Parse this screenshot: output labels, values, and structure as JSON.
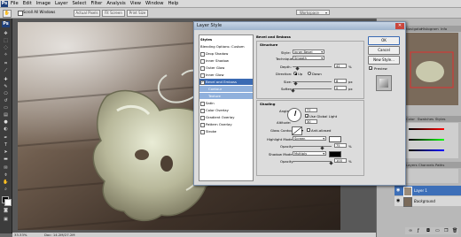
{
  "app_logo": "Ps",
  "menu": [
    "File",
    "Edit",
    "Image",
    "Layer",
    "Select",
    "Filter",
    "Analysis",
    "View",
    "Window",
    "Help"
  ],
  "options_bar": {
    "scroll_all_windows": "Scroll All Windows",
    "actual_pixels": "Actual Pixels",
    "fit_screen": "Fit Screen",
    "print_size": "Print Size",
    "workspace": "Workspace"
  },
  "status_bar": {
    "zoom": "33.33%",
    "doc": "Doc: 14.2M/27.2M"
  },
  "dialog": {
    "title": "Layer Style",
    "styles_list": [
      {
        "label": "Styles",
        "checkbox": false,
        "state": "header"
      },
      {
        "label": "Blending Options: Custom",
        "checkbox": false,
        "state": "header"
      },
      {
        "label": "Drop Shadow",
        "checkbox": true,
        "state": "normal"
      },
      {
        "label": "Inner Shadow",
        "checkbox": true,
        "state": "normal"
      },
      {
        "label": "Outer Glow",
        "checkbox": true,
        "state": "normal"
      },
      {
        "label": "Inner Glow",
        "checkbox": true,
        "state": "normal"
      },
      {
        "label": "Bevel and Emboss",
        "checkbox": true,
        "state": "selected"
      },
      {
        "label": "Contour",
        "checkbox": true,
        "state": "sub"
      },
      {
        "label": "Texture",
        "checkbox": true,
        "state": "sub"
      },
      {
        "label": "Satin",
        "checkbox": true,
        "state": "normal"
      },
      {
        "label": "Color Overlay",
        "checkbox": true,
        "state": "normal"
      },
      {
        "label": "Gradient Overlay",
        "checkbox": true,
        "state": "normal"
      },
      {
        "label": "Pattern Overlay",
        "checkbox": true,
        "state": "normal"
      },
      {
        "label": "Stroke",
        "checkbox": true,
        "state": "normal"
      }
    ],
    "section_title": "Bevel and Emboss",
    "structure": {
      "title": "Structure",
      "style_label": "Style:",
      "style_value": "Inner Bevel",
      "technique_label": "Technique:",
      "technique_value": "Smooth",
      "depth_label": "Depth:",
      "depth_value": "42",
      "direction_label": "Direction:",
      "direction_up": "Up",
      "direction_down": "Down",
      "size_label": "Size:",
      "size_value": "8",
      "soften_label": "Soften:",
      "soften_value": "0",
      "percent": "%",
      "px": "px"
    },
    "shading": {
      "title": "Shading",
      "angle_label": "Angle:",
      "angle_value": "77",
      "use_global_light": "Use Global Light",
      "altitude_label": "Altitude:",
      "altitude_value": "30",
      "gloss_contour_label": "Gloss Contour:",
      "anti_aliased": "Anti-aliased",
      "highlight_mode_label": "Highlight Mode:",
      "highlight_mode_value": "Screen",
      "highlight_opacity_label": "Opacity:",
      "highlight_opacity_value": "75",
      "shadow_mode_label": "Shadow Mode:",
      "shadow_mode_value": "Multiply",
      "shadow_opacity_label": "Opacity:",
      "shadow_opacity_value": "100",
      "percent": "%"
    },
    "buttons": {
      "ok": "OK",
      "cancel": "Cancel",
      "new_style": "New Style...",
      "preview": "Preview"
    }
  },
  "panels": {
    "navigator_tabs": [
      "Navigator",
      "Histogram",
      "Info"
    ],
    "color_tabs": [
      "Color",
      "Swatches",
      "Styles"
    ],
    "layers_tabs": [
      "Layers",
      "Channels",
      "Paths"
    ],
    "layers": [
      {
        "name": "Layer 1",
        "selected": true
      },
      {
        "name": "Background",
        "selected": false
      }
    ]
  },
  "colors": {
    "dialog_selected": "#3a6ab3",
    "dialog_sub": "#8fb0dc",
    "layer_selected": "#3d6fb8"
  }
}
